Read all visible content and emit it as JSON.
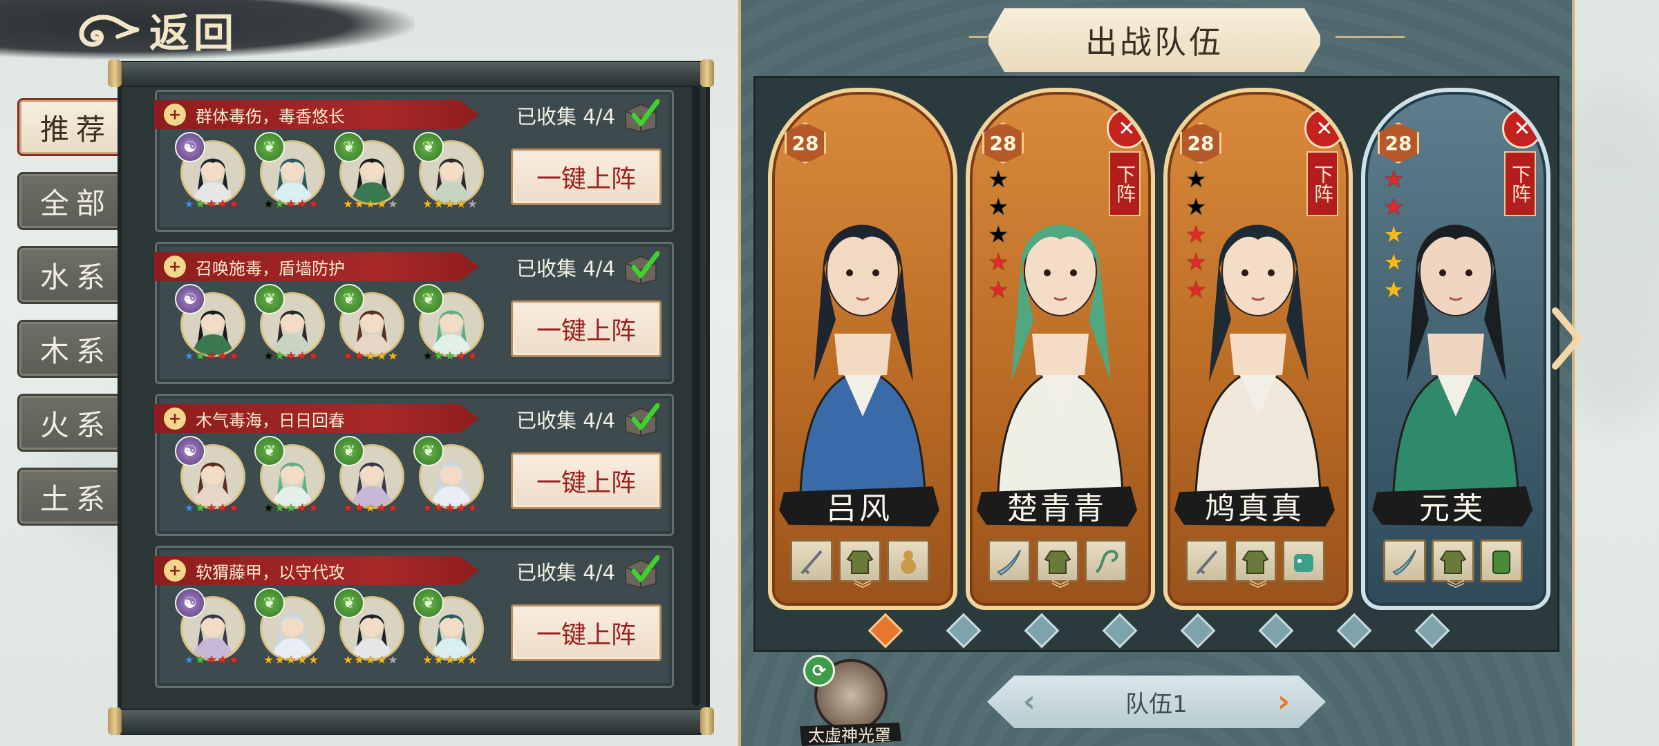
{
  "back": {
    "label": "返回"
  },
  "tabs": [
    {
      "label": "推荐",
      "active": true
    },
    {
      "label": "全部",
      "active": false
    },
    {
      "label": "水系",
      "active": false
    },
    {
      "label": "木系",
      "active": false
    },
    {
      "label": "火系",
      "active": false
    },
    {
      "label": "土系",
      "active": false
    }
  ],
  "lineups": [
    {
      "title": "群体毒伤，毒香悠长",
      "collected": "已收集 4/4",
      "button": "一键上阵",
      "members": [
        {
          "element": "yin",
          "stars": [
            "blue",
            "green",
            "red",
            "red",
            "red"
          ]
        },
        {
          "element": "wood",
          "stars": [
            "rainbow",
            "green",
            "red",
            "red",
            "red"
          ]
        },
        {
          "element": "wood",
          "stars": [
            "gold",
            "gold",
            "gold",
            "gold",
            "gray"
          ]
        },
        {
          "element": "wood",
          "stars": [
            "gold",
            "gold",
            "gold",
            "gold",
            "gray"
          ]
        }
      ]
    },
    {
      "title": "召唤施毒，盾墙防护",
      "collected": "已收集 4/4",
      "button": "一键上阵",
      "members": [
        {
          "element": "yin",
          "stars": [
            "blue",
            "green",
            "red",
            "red",
            "red"
          ]
        },
        {
          "element": "wood",
          "stars": [
            "rainbow",
            "green",
            "red",
            "red",
            "red"
          ]
        },
        {
          "element": "wood",
          "stars": [
            "red",
            "red",
            "gold",
            "gold",
            "gold"
          ]
        },
        {
          "element": "wood",
          "stars": [
            "rainbow",
            "green",
            "green",
            "red",
            "red"
          ]
        }
      ]
    },
    {
      "title": "木气毒海，日日回春",
      "collected": "已收集 4/4",
      "button": "一键上阵",
      "members": [
        {
          "element": "yin",
          "stars": [
            "blue",
            "green",
            "red",
            "red",
            "red"
          ]
        },
        {
          "element": "wood",
          "stars": [
            "rainbow",
            "green",
            "green",
            "red",
            "red"
          ]
        },
        {
          "element": "wood",
          "stars": [
            "red",
            "red",
            "gold",
            "red",
            "red"
          ]
        },
        {
          "element": "wood",
          "stars": [
            "red",
            "red",
            "red",
            "red",
            "red"
          ]
        }
      ]
    },
    {
      "title": "软猬藤甲，以守代攻",
      "collected": "已收集 4/4",
      "button": "一键上阵",
      "members": [
        {
          "element": "yin",
          "stars": [
            "blue",
            "green",
            "red",
            "red",
            "red"
          ]
        },
        {
          "element": "wood",
          "stars": [
            "gold",
            "gold",
            "gold",
            "gold",
            "gold"
          ]
        },
        {
          "element": "wood",
          "stars": [
            "gold",
            "gold",
            "gold",
            "gold",
            "gray"
          ]
        },
        {
          "element": "wood",
          "stars": [
            "gold",
            "gold",
            "gold",
            "gold",
            "gold"
          ]
        }
      ]
    }
  ],
  "team": {
    "title": "出战队伍",
    "heroes": [
      {
        "name": "吕风",
        "level": "28",
        "frame": "orange",
        "removable": false,
        "stars": [],
        "equip": [
          "sword",
          "robe",
          "gourd"
        ],
        "palette": {
          "robe": "#3b6aa8",
          "hair": "#1e2430",
          "skin": "#f1d9c2"
        }
      },
      {
        "name": "楚青青",
        "level": "28",
        "frame": "orange",
        "removable": true,
        "stars": [
          "rainbow",
          "rainbow",
          "rainbow",
          "red",
          "red"
        ],
        "equip": [
          "blade",
          "robe",
          "whip"
        ],
        "palette": {
          "robe": "#eef0e6",
          "hair": "#4fa880",
          "skin": "#f4dcc6"
        }
      },
      {
        "name": "鸠真真",
        "level": "28",
        "frame": "orange",
        "removable": true,
        "stars": [
          "rainbow",
          "rainbow",
          "red",
          "red",
          "red"
        ],
        "equip": [
          "sword",
          "robe",
          "beast"
        ],
        "palette": {
          "robe": "#efe8da",
          "hair": "#1e2a34",
          "skin": "#f4dcc6"
        }
      },
      {
        "name": "元芙",
        "level": "28",
        "frame": "blue",
        "removable": true,
        "stars": [
          "red",
          "red",
          "gold",
          "gold",
          "gold"
        ],
        "equip": [
          "blade",
          "robe",
          "armor"
        ],
        "palette": {
          "robe": "#2e8a6a",
          "hair": "#1a1f24",
          "skin": "#f0d6c0"
        }
      }
    ],
    "remove_label": "下阵",
    "page_count": 8,
    "page_active": 0,
    "skill_label": "太虚神光罩",
    "team_label": "队伍1"
  },
  "colors": {
    "accent": "#e8772e",
    "banner": "#a92828",
    "panel": "#4e686d"
  }
}
